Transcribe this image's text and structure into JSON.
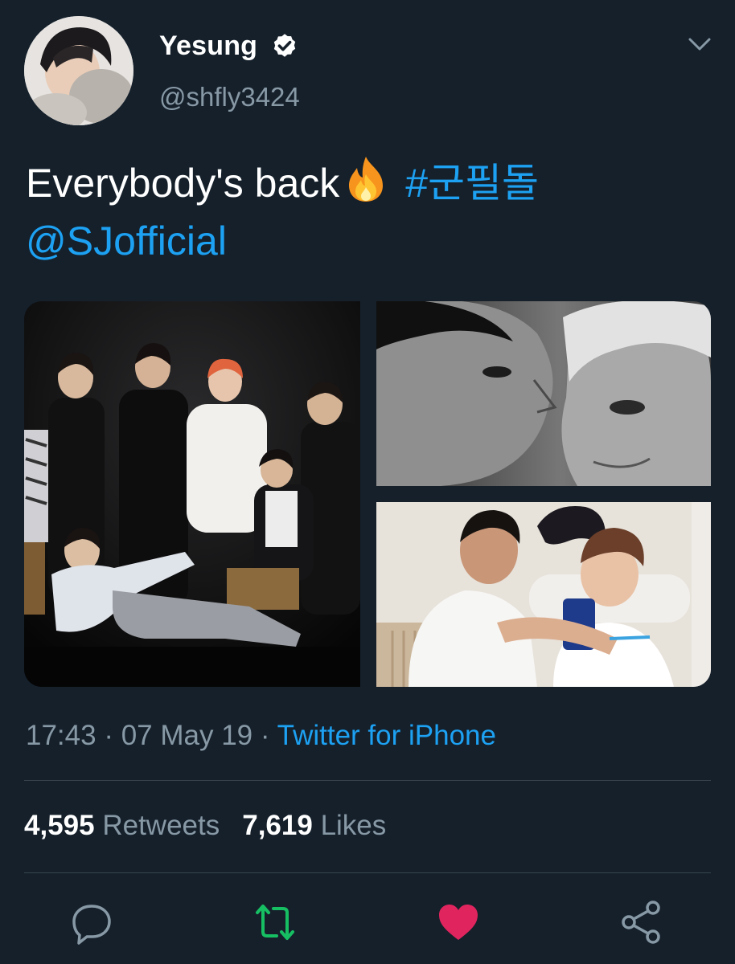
{
  "author": {
    "display_name": "Yesung",
    "handle": "@shfly3424",
    "verified": true,
    "avatar": "avatar-photo"
  },
  "tweet": {
    "text": "Everybody's back",
    "emoji": "fire-emoji",
    "hashtag": "#군필돌",
    "mention": "@SJofficial"
  },
  "media": [
    {
      "name": "group-photo"
    },
    {
      "name": "black-white-closeup-photo"
    },
    {
      "name": "hug-photo"
    }
  ],
  "meta": {
    "time": "17:43",
    "date": "07 May 19",
    "separator": "·",
    "source": "Twitter for iPhone"
  },
  "stats": {
    "retweets_count": "4,595",
    "retweets_label": "Retweets",
    "likes_count": "7,619",
    "likes_label": "Likes"
  },
  "actions": {
    "reply_icon": "reply-icon",
    "retweet_icon": "retweet-icon",
    "like_icon": "heart-icon",
    "share_icon": "share-icon"
  },
  "colors": {
    "background": "#15202b",
    "text": "#ffffff",
    "secondary": "#8899a6",
    "link": "#1da1f2",
    "retweet": "#17bf63",
    "like": "#e0245e",
    "divider": "#38444d"
  }
}
